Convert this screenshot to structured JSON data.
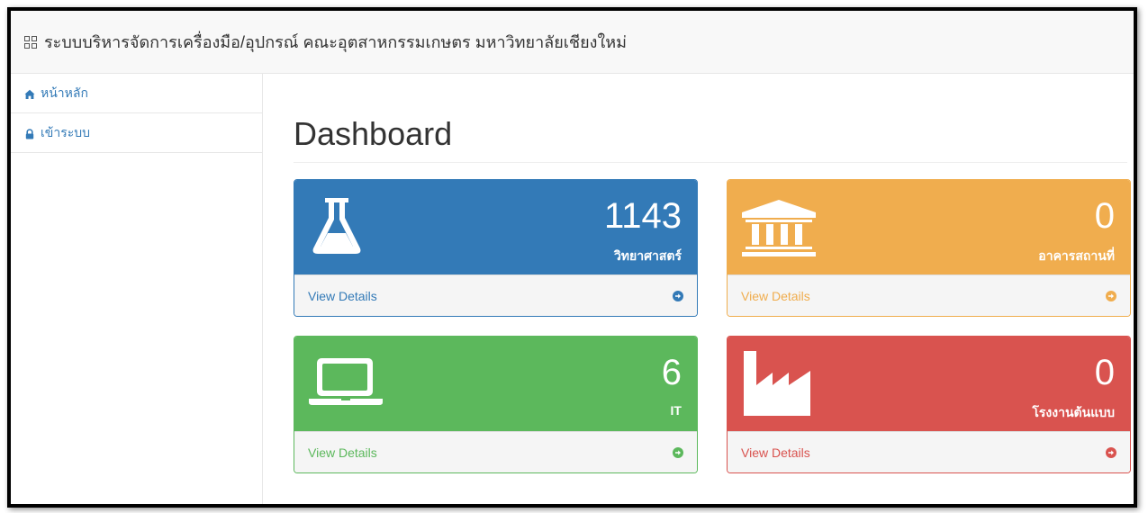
{
  "navbar": {
    "icon": "qrcode-icon",
    "title": "ระบบบริหารจัดการเครื่องมือ/อุปกรณ์ คณะอุตสาหกรรมเกษตร มหาวิทยาลัยเชียงใหม่"
  },
  "sidebar": {
    "items": [
      {
        "label": "หน้าหลัก",
        "icon": "home-icon"
      },
      {
        "label": "เข้าระบบ",
        "icon": "lock-icon"
      }
    ]
  },
  "page": {
    "title": "Dashboard"
  },
  "panels": [
    {
      "count": "1143",
      "label": "วิทยาศาสตร์",
      "footer": "View Details",
      "icon": "flask-icon",
      "color": "#337ab7"
    },
    {
      "count": "0",
      "label": "อาคารสถานที่",
      "footer": "View Details",
      "icon": "bank-icon",
      "color": "#f0ad4e"
    },
    {
      "count": "6",
      "label": "IT",
      "footer": "View Details",
      "icon": "laptop-icon",
      "color": "#5cb85c"
    },
    {
      "count": "0",
      "label": "โรงงานต้นแบบ",
      "footer": "View Details",
      "icon": "industry-icon",
      "color": "#d9534f"
    }
  ]
}
